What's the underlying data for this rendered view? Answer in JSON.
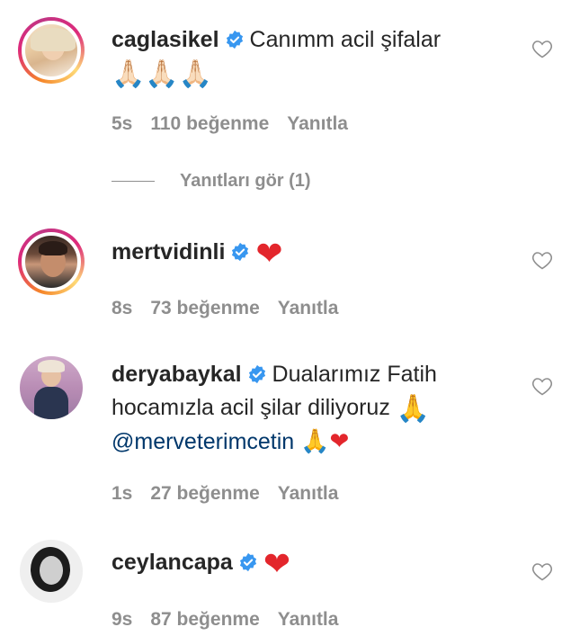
{
  "comments": [
    {
      "username": "caglasikel",
      "text": "Canımm acil şifalar",
      "emoji_line": "🙏🏻🙏🏻🙏🏻",
      "time": "5s",
      "likes": "110 beğenme",
      "reply": "Yanıtla",
      "view_replies": "Yanıtları gör (1)"
    },
    {
      "username": "mertvidinli",
      "text": "❤",
      "time": "8s",
      "likes": "73 beğenme",
      "reply": "Yanıtla"
    },
    {
      "username": "deryabaykal",
      "text_line1": "Dualarımız Fatih",
      "text_line2": "hocamızla acil şilar diliyoruz",
      "text_line2_emoji": "🙏",
      "mention": "@merveterimcetin",
      "text_line3_emoji": "🙏❤",
      "time": "1s",
      "likes": "27 beğenme",
      "reply": "Yanıtla"
    },
    {
      "username": "ceylancapa",
      "text": "❤",
      "time": "9s",
      "likes": "87 beğenme",
      "reply": "Yanıtla"
    }
  ],
  "colors": {
    "verified_blue": "#3897f0",
    "meta_gray": "#8e8e8e",
    "mention_blue": "#00376b",
    "heart_red": "#e3262c"
  },
  "icons": [
    "verified-badge-icon",
    "heart-outline-icon"
  ]
}
